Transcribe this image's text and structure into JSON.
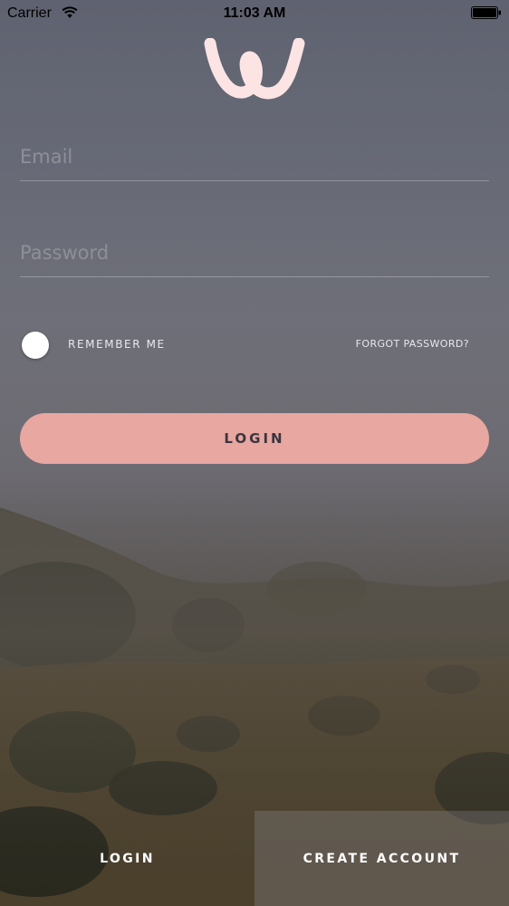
{
  "status_bar": {
    "carrier": "Carrier",
    "time": "11:03 AM",
    "wifi_icon": "wifi-icon",
    "battery_icon": "battery-icon"
  },
  "logo": {
    "icon": "w-logo-icon",
    "color": "#fce4e4"
  },
  "form": {
    "email_placeholder": "Email",
    "email_value": "",
    "password_placeholder": "Password",
    "password_value": "",
    "remember_label": "REMEMBER ME",
    "remember_checked": false,
    "forgot_label": "FORGOT PASSWORD?",
    "login_label": "LOGIN"
  },
  "bottom_tabs": {
    "login_label": "LOGIN",
    "create_account_label": "CREATE ACCOUNT"
  },
  "colors": {
    "accent": "#e8a7a1",
    "text_light": "#ffffff"
  }
}
